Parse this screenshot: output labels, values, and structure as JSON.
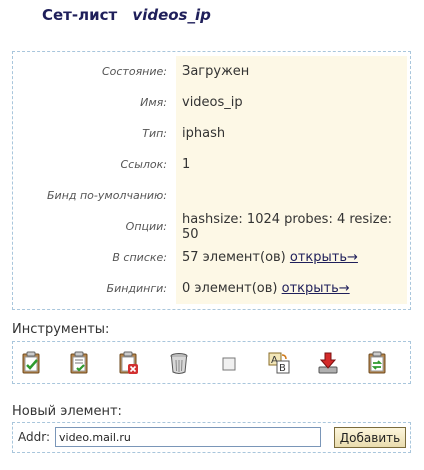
{
  "header": {
    "title": "Сет-лист",
    "set_name": "videos_ip"
  },
  "info": {
    "rows": [
      {
        "label": "Состояние:",
        "value": "Загружен"
      },
      {
        "label": "Имя:",
        "value": "videos_ip"
      },
      {
        "label": "Тип:",
        "value": "iphash"
      },
      {
        "label": "Ссылок:",
        "value": "1"
      },
      {
        "label": "Бинд по-умолчанию:",
        "value": ""
      },
      {
        "label": "Опции:",
        "value": "hashsize: 1024 probes: 4 resize: 50"
      },
      {
        "label": "В списке:",
        "value": "57 элемент(ов)",
        "link": "открыть→"
      },
      {
        "label": "Биндинги:",
        "value": "0 элемент(ов)",
        "link": "открыть→"
      }
    ]
  },
  "tools": {
    "label": "Инструменты:",
    "icons": [
      "clipboard-check-icon",
      "clipboard-list-icon",
      "clipboard-delete-icon",
      "trash-can-icon",
      "checkbox-icon",
      "rename-icon",
      "download-icon",
      "clipboard-swap-icon"
    ]
  },
  "new_item": {
    "label": "Новый элемент:",
    "addr_label": "Addr:",
    "addr_value": "video.mail.ru",
    "add_button": "Добавить"
  }
}
